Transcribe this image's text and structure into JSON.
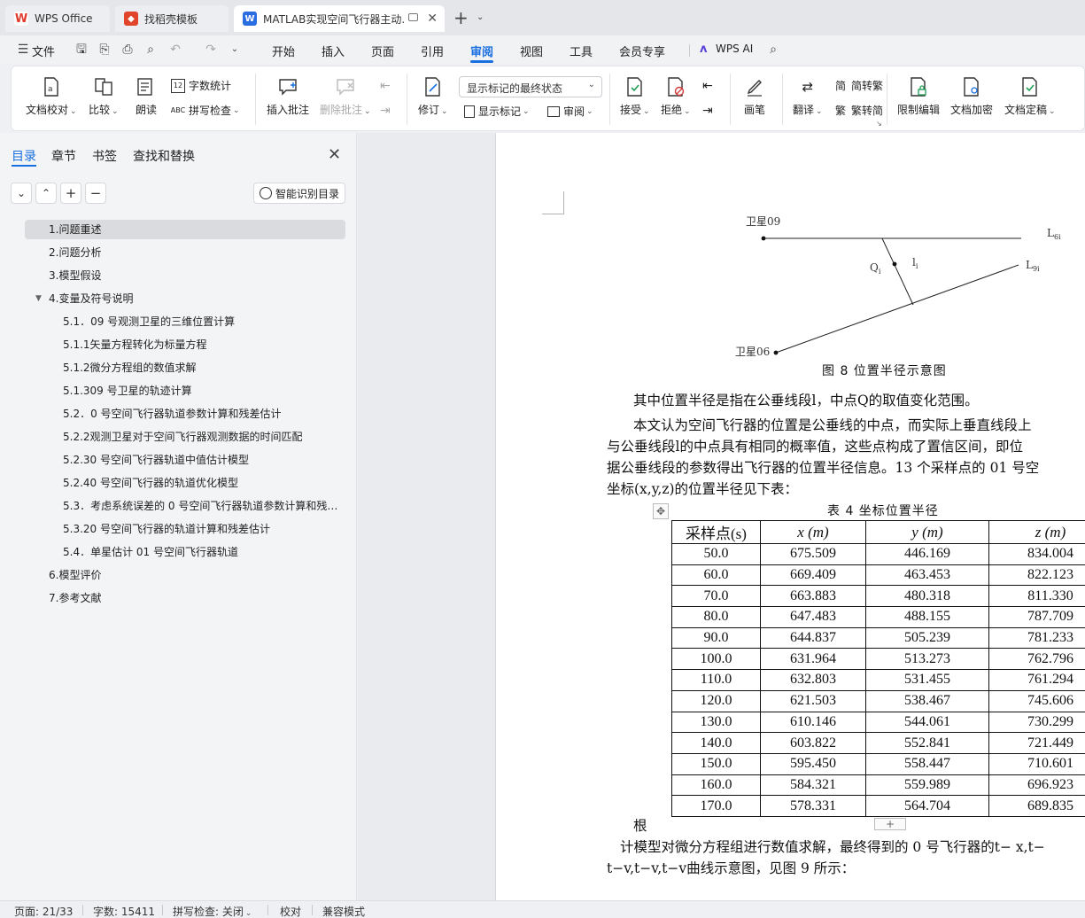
{
  "tabs": [
    {
      "label": "WPS Office",
      "icon": "wps-logo-icon"
    },
    {
      "label": "找稻壳模板",
      "icon": "daoke-logo-icon"
    },
    {
      "label": "MATLAB实现空间飞行器主动...",
      "icon": "word-doc-icon"
    }
  ],
  "menubar": {
    "file": "文件",
    "items": [
      "开始",
      "插入",
      "页面",
      "引用",
      "审阅",
      "视图",
      "工具",
      "会员专享"
    ],
    "active": "审阅",
    "wps_ai": "WPS AI"
  },
  "ribbon": {
    "proofread": "文档校对",
    "compare": "比较",
    "read_aloud": "朗读",
    "word_count": "字数统计",
    "spell_check": "拼写检查",
    "insert_comment": "插入批注",
    "delete_comment": "删除批注",
    "track": "修订",
    "display_select": "显示标记的最终状态",
    "show_markup": "显示标记",
    "review": "审阅",
    "accept": "接受",
    "reject": "拒绝",
    "pen": "画笔",
    "translate": "翻译",
    "to_traditional": "简转繁",
    "to_simplified": "繁转简",
    "restrict_edit": "限制编辑",
    "encrypt": "文档加密",
    "finalize": "文档定稿"
  },
  "sidebar": {
    "tabs": [
      "目录",
      "章节",
      "书签",
      "查找和替换"
    ],
    "smart_toc": "智能识别目录",
    "toc": [
      {
        "label": "1.问题重述",
        "level": 1,
        "active": true
      },
      {
        "label": "2.问题分析",
        "level": 1
      },
      {
        "label": "3.模型假设",
        "level": 1
      },
      {
        "label": "4.变量及符号说明",
        "level": 1,
        "expanded": true
      },
      {
        "label": "5.1．09 号观测卫星的三维位置计算",
        "level": 2
      },
      {
        "label": "5.1.1矢量方程转化为标量方程",
        "level": 2
      },
      {
        "label": "5.1.2微分方程组的数值求解",
        "level": 2
      },
      {
        "label": "5.1.309 号卫星的轨迹计算",
        "level": 2
      },
      {
        "label": "5.2．0 号空间飞行器轨道参数计算和残差估计",
        "level": 2
      },
      {
        "label": "5.2.2观测卫星对于空间飞行器观测数据的时间匹配",
        "level": 2
      },
      {
        "label": "5.2.30 号空间飞行器轨道中值估计模型",
        "level": 2
      },
      {
        "label": "5.2.40 号空间飞行器的轨道优化模型",
        "level": 2
      },
      {
        "label": "5.3．考虑系统误差的 0 号空间飞行器轨道参数计算和残差估计",
        "level": 2
      },
      {
        "label": "5.3.20 号空间飞行器的轨道计算和残差估计",
        "level": 2
      },
      {
        "label": "5.4．单星估计 01 号空间飞行器轨道",
        "level": 2
      },
      {
        "label": "6.模型评价",
        "level": 1
      },
      {
        "label": "7.参考文献",
        "level": 1
      }
    ]
  },
  "document": {
    "figure": {
      "sat09": "卫星09",
      "sat06": "卫星06",
      "L6": "L",
      "L6_sub": "6i",
      "L9": "L",
      "L9_sub": "9i",
      "Q": "Q",
      "Q_sub": "i",
      "l": "l",
      "l_sub": "i"
    },
    "figure_caption": "图 8 位置半径示意图",
    "para1": "其中位置半径是指在公垂线段l，中点Q的取值变化范围。",
    "para2_line1": "本文认为空间飞行器的位置是公垂线的中点，而实际上垂直线段上",
    "para2_line2": "与公垂线段l的中点具有相同的概率值，这些点构成了置信区间，即位",
    "para2_line3": "据公垂线段的参数得出飞行器的位置半径信息。13 个采样点的 01 号空",
    "para2_line4": "坐标(x,y,z)的位置半径见下表：",
    "table_caption": "表 4 坐标位置半径",
    "table": {
      "headers": [
        "采样点(s)",
        "x (m)",
        "y (m)",
        "z (m)"
      ],
      "rows": [
        [
          "50.0",
          "675.509",
          "446.169",
          "834.004"
        ],
        [
          "60.0",
          "669.409",
          "463.453",
          "822.123"
        ],
        [
          "70.0",
          "663.883",
          "480.318",
          "811.330"
        ],
        [
          "80.0",
          "647.483",
          "488.155",
          "787.709"
        ],
        [
          "90.0",
          "644.837",
          "505.239",
          "781.233"
        ],
        [
          "100.0",
          "631.964",
          "513.273",
          "762.796"
        ],
        [
          "110.0",
          "632.803",
          "531.455",
          "761.294"
        ],
        [
          "120.0",
          "621.503",
          "538.467",
          "745.606"
        ],
        [
          "130.0",
          "610.146",
          "544.061",
          "730.299"
        ],
        [
          "140.0",
          "603.822",
          "552.841",
          "721.449"
        ],
        [
          "150.0",
          "595.450",
          "558.447",
          "710.601"
        ],
        [
          "160.0",
          "584.321",
          "559.989",
          "696.923"
        ],
        [
          "170.0",
          "578.331",
          "564.704",
          "689.835"
        ]
      ]
    },
    "para3_frag": "根",
    "para4_line1": "计模型对微分方程组进行数值求解，最终得到的 0 号飞行器的t− x,t−",
    "para4_line2": "t−v,t−v,t−v曲线示意图，见图 9 所示："
  },
  "statusbar": {
    "page": "页面: 21/33",
    "words": "字数: 15411",
    "spell": "拼写检查: 关闭",
    "proof": "校对",
    "compat": "兼容模式"
  }
}
